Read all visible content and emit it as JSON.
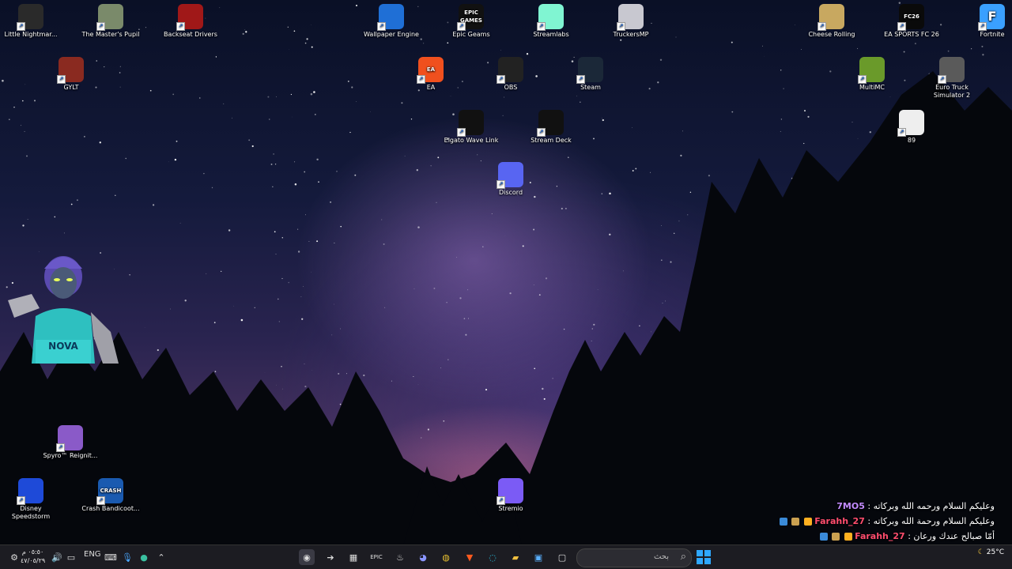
{
  "desktop_icons": [
    {
      "label": "Little Nightmar...",
      "icon": "little-nightmares-icon",
      "color": "#2a2a2a"
    },
    {
      "label": "The Master's Pupil",
      "icon": "painting-icon",
      "color": "#7a8a6a"
    },
    {
      "label": "Backseat Drivers",
      "icon": "red-car-icon",
      "color": "#a01818"
    },
    {
      "label": "GYLT",
      "icon": "gylt-icon",
      "color": "#8a2a20"
    },
    {
      "label": "Wallpaper Engine",
      "icon": "wallpaper-engine-icon",
      "color": "#1f6fd6"
    },
    {
      "label": "Epic Geams",
      "icon": "epic-games-icon",
      "color": "#111111"
    },
    {
      "label": "Streamlabs",
      "icon": "streamlabs-icon",
      "color": "#80f5d2"
    },
    {
      "label": "TruckersMP",
      "icon": "truckersmp-icon",
      "color": "#c8c8d0"
    },
    {
      "label": "EA",
      "icon": "ea-icon",
      "color": "#f0501e"
    },
    {
      "label": "OBS",
      "icon": "obs-icon",
      "color": "#222222"
    },
    {
      "label": "Steam",
      "icon": "steam-icon",
      "color": "#1b2838"
    },
    {
      "label": "Elgato Wave Link",
      "icon": "elgato-wave-link-icon",
      "color": "#111111"
    },
    {
      "label": "Stream Deck",
      "icon": "stream-deck-icon",
      "color": "#111111"
    },
    {
      "label": "Discord",
      "icon": "discord-icon",
      "color": "#5865f2"
    },
    {
      "label": "Cheese Rolling",
      "icon": "cheese-icon",
      "color": "#c8a860"
    },
    {
      "label": "EA SPORTS FC 26",
      "icon": "ea-fc-icon",
      "color": "#0a0a0a"
    },
    {
      "label": "Fortnite",
      "icon": "fortnite-icon",
      "color": "#3aa0ff"
    },
    {
      "label": "MultiMC",
      "icon": "multimc-icon",
      "color": "#6a9a2a"
    },
    {
      "label": "Euro Truck Simulator 2",
      "icon": "euro-truck-icon",
      "color": "#5a5a5a"
    },
    {
      "label": "89",
      "icon": "ghost-icon",
      "color": "#eeeeee"
    },
    {
      "label": "Spyro™ Reignit...",
      "icon": "spyro-icon",
      "color": "#8a5ac8"
    },
    {
      "label": "Disney Speedstorm",
      "icon": "disney-speedstorm-icon",
      "color": "#1e4ad8"
    },
    {
      "label": "Crash Bandicoot...",
      "icon": "crash-icon",
      "color": "#1a5ab0"
    },
    {
      "label": "Stremio",
      "icon": "stremio-icon",
      "color": "#7b5bf5"
    }
  ],
  "icon_text": {
    "epic": "EPIC GAMES",
    "ea": "EA",
    "fc": "FC26",
    "fortnite": "F",
    "crash": "CRASH"
  },
  "avatar": {
    "text": "NOVA"
  },
  "chat": [
    {
      "user": "7MO5",
      "text": "وعليكم السلام ورحمه الله وبركاته",
      "user_color": "#c38cff"
    },
    {
      "user": "Farahh_27",
      "text": "وعليكم السلام ورحمة الله وبركاته",
      "user_color": "#ff4d6d"
    },
    {
      "user": "Farahh_27",
      "text": "أمّا صبالح عندك ورعان",
      "user_color": "#ff4d6d"
    }
  ],
  "taskbar": {
    "search_placeholder": "بحث",
    "language": "ENG",
    "clock_time": "٠٥:٥٠ م",
    "clock_date": "٤٧/٠٥/٢٩",
    "weather": "25°C",
    "apps": [
      "chrome-recording-icon",
      "arrow-app-icon",
      "stream-deck-icon",
      "epic-games-icon",
      "steam-icon",
      "discord-icon",
      "chrome-icon",
      "brave-icon",
      "edge-icon",
      "file-explorer-icon",
      "store-icon",
      "window-icon"
    ]
  }
}
